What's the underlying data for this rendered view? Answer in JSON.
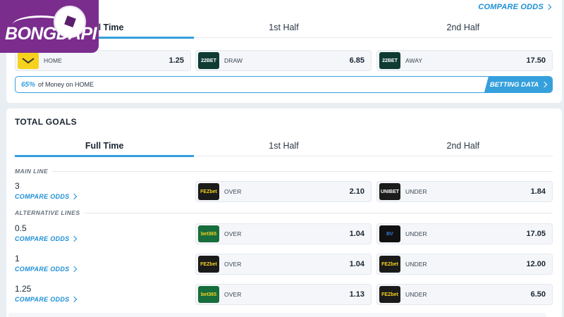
{
  "brand": {
    "logo_text": "BONGDAPI"
  },
  "moneyline": {
    "compare_label": "COMPARE ODDS",
    "tabs": [
      "Full Time",
      "1st Half",
      "2nd Half"
    ],
    "odds": [
      {
        "bookmaker_icon": "bookmaker-logo-yellow",
        "label": "HOME",
        "value": "1.25"
      },
      {
        "bookmaker_icon": "22bet-logo",
        "label": "DRAW",
        "value": "6.85"
      },
      {
        "bookmaker_icon": "22bet-logo",
        "label": "AWAY",
        "value": "17.50"
      }
    ],
    "money": {
      "percent": "65%",
      "text": "of Money on HOME"
    },
    "betting_data_label": "BETTING DATA"
  },
  "total_goals": {
    "title": "TOTAL GOALS",
    "tabs": [
      "Full Time",
      "1st Half",
      "2nd Half"
    ],
    "main_line_label": "MAIN LINE",
    "alt_lines_label": "ALTERNATIVE LINES",
    "compare_label": "COMPARE ODDS",
    "rows": [
      {
        "line": "3",
        "over_book": "FEZbet",
        "over_label": "OVER",
        "over_value": "2.10",
        "under_book": "UNIBET",
        "under_label": "UNDER",
        "under_value": "1.84"
      },
      {
        "line": "0.5",
        "over_book": "bet365",
        "over_label": "OVER",
        "over_value": "1.04",
        "under_book": "BetVictor",
        "under_label": "UNDER",
        "under_value": "17.05"
      },
      {
        "line": "1",
        "over_book": "FEZbet",
        "over_label": "OVER",
        "over_value": "1.04",
        "under_book": "FEZbet",
        "under_label": "UNDER",
        "under_value": "12.00"
      },
      {
        "line": "1.25",
        "over_book": "bet365",
        "over_label": "OVER",
        "over_value": "1.13",
        "under_book": "FEZbet",
        "under_label": "UNDER",
        "under_value": "6.50"
      }
    ]
  },
  "colors": {
    "accent": "#35a0dc",
    "brand": "#7b2d8e",
    "22bet": "#0f3b33",
    "bet365": "#176d3b",
    "fezbet": "#1b1b1b",
    "yellow": "#f6d21f"
  }
}
